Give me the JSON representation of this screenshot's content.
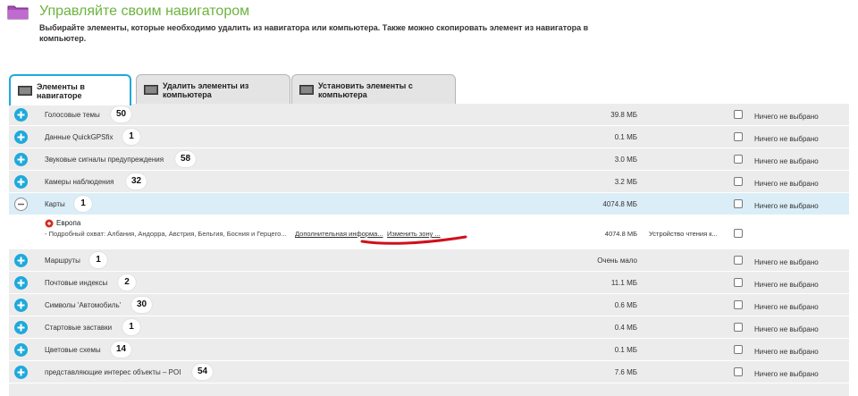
{
  "header": {
    "title": "Управляйте своим навигатором",
    "description": "Выбирайте элементы, которые необходимо удалить из навигатора или компьютера. Также можно скопировать элемент из навигатора в компьютер."
  },
  "tabs": [
    {
      "label": "Элементы в навигаторе",
      "active": true
    },
    {
      "label": "Удалить элементы из компьютера",
      "active": false
    },
    {
      "label": "Установить элементы с компьютера",
      "active": false
    }
  ],
  "rows": [
    {
      "label": "Голосовые темы",
      "count": "50",
      "size": "39.8 МБ",
      "status": "Ничего не выбрано"
    },
    {
      "label": "Данные QuickGPSfix",
      "count": "1",
      "size": "0.1 МБ",
      "status": "Ничего не выбрано"
    },
    {
      "label": "Звуковые сигналы предупреждения",
      "count": "58",
      "size": "3.0 МБ",
      "status": "Ничего не выбрано"
    },
    {
      "label": "Камеры наблюдения",
      "count": "32",
      "size": "3.2 МБ",
      "status": "Ничего не выбрано"
    },
    {
      "label": "Карты",
      "count": "1",
      "size": "4074.8 МБ",
      "status": "Ничего не выбрано",
      "expanded": true
    },
    {
      "label": "Маршруты",
      "count": "1",
      "size": "Очень мало",
      "status": "Ничего не выбрано"
    },
    {
      "label": "Почтовые индексы",
      "count": "2",
      "size": "11.1 МБ",
      "status": "Ничего не выбрано"
    },
    {
      "label": "Символы 'Автомобиль'",
      "count": "30",
      "size": "0.6 МБ",
      "status": "Ничего не выбрано"
    },
    {
      "label": "Стартовые заставки",
      "count": "1",
      "size": "0.4 МБ",
      "status": "Ничего не выбрано"
    },
    {
      "label": "Цветовые схемы",
      "count": "14",
      "size": "0.1 МБ",
      "status": "Ничего не выбрано"
    },
    {
      "label": "представляющие интерес объекты – POI",
      "count": "54",
      "size": "7.6 МБ",
      "status": "Ничего не выбрано"
    }
  ],
  "map_item": {
    "name": "Европа",
    "description": "- Подробный охват: Албания, Андорра, Австрия, Бельгия, Босния и Герцего...",
    "more_info_link": "Дополнительная информа...",
    "change_zone_link": "Изменить зону ...",
    "size": "4074.8 МБ",
    "location": "Устройство чтения к..."
  },
  "colors": {
    "accent": "#1fa9db",
    "title_green": "#6cb33e",
    "annotation_red": "#d0101a"
  }
}
